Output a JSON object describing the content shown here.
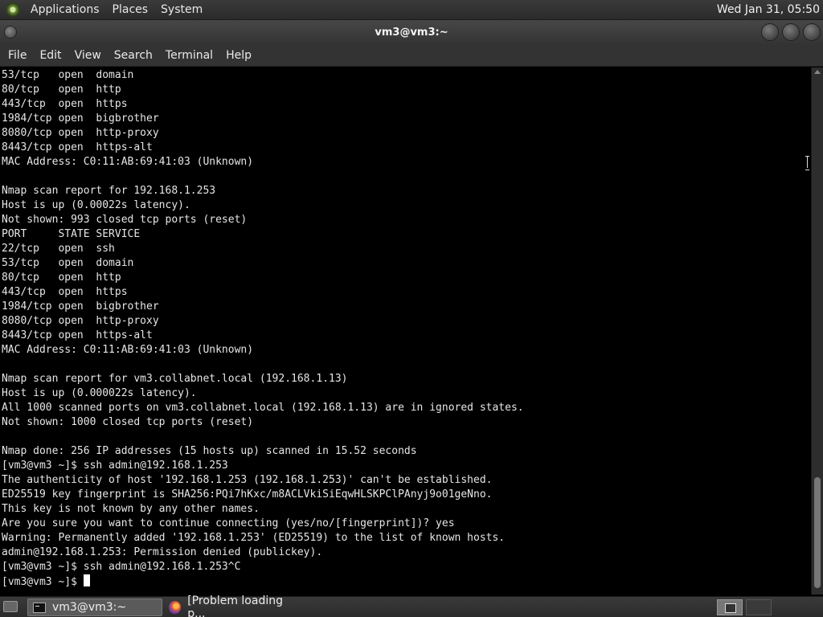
{
  "top_panel": {
    "menu": [
      "Applications",
      "Places",
      "System"
    ],
    "clock": "Wed Jan 31, 05:50"
  },
  "window": {
    "title": "vm3@vm3:~",
    "menu": [
      "File",
      "Edit",
      "View",
      "Search",
      "Terminal",
      "Help"
    ]
  },
  "terminal": {
    "lines": [
      "53/tcp   open  domain",
      "80/tcp   open  http",
      "443/tcp  open  https",
      "1984/tcp open  bigbrother",
      "8080/tcp open  http-proxy",
      "8443/tcp open  https-alt",
      "MAC Address: C0:11:AB:69:41:03 (Unknown)",
      "",
      "Nmap scan report for 192.168.1.253",
      "Host is up (0.00022s latency).",
      "Not shown: 993 closed tcp ports (reset)",
      "PORT     STATE SERVICE",
      "22/tcp   open  ssh",
      "53/tcp   open  domain",
      "80/tcp   open  http",
      "443/tcp  open  https",
      "1984/tcp open  bigbrother",
      "8080/tcp open  http-proxy",
      "8443/tcp open  https-alt",
      "MAC Address: C0:11:AB:69:41:03 (Unknown)",
      "",
      "Nmap scan report for vm3.collabnet.local (192.168.1.13)",
      "Host is up (0.000022s latency).",
      "All 1000 scanned ports on vm3.collabnet.local (192.168.1.13) are in ignored states.",
      "Not shown: 1000 closed tcp ports (reset)",
      "",
      "Nmap done: 256 IP addresses (15 hosts up) scanned in 15.52 seconds",
      "[vm3@vm3 ~]$ ssh admin@192.168.1.253",
      "The authenticity of host '192.168.1.253 (192.168.1.253)' can't be established.",
      "ED25519 key fingerprint is SHA256:PQi7hKxc/m8ACLVkiSiEqwHLSKPClPAnyj9o01geNno.",
      "This key is not known by any other names.",
      "Are you sure you want to continue connecting (yes/no/[fingerprint])? yes",
      "Warning: Permanently added '192.168.1.253' (ED25519) to the list of known hosts.",
      "admin@192.168.1.253: Permission denied (publickey).",
      "[vm3@vm3 ~]$ ssh admin@192.168.1.253^C"
    ],
    "prompt": "[vm3@vm3 ~]$ "
  },
  "taskbar": {
    "tasks": [
      "vm3@vm3:~",
      "[Problem loading p..."
    ]
  }
}
